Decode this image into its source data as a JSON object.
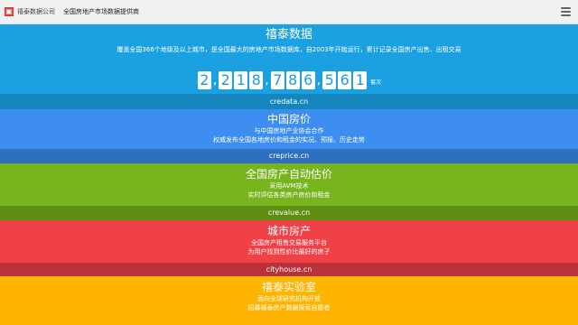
{
  "header": {
    "logo_glyph": "▣",
    "company": "禧泰数据公司",
    "tagline": "全国房地产市场数据提供商",
    "menu_icon": "hamburger-menu-icon"
  },
  "counter": {
    "digits": [
      "2",
      "218",
      "786",
      "561"
    ],
    "unit": "套次"
  },
  "sections": [
    {
      "title": "禧泰数据",
      "lines": [
        "覆盖全国366个地级及以上城市，是全国最大的房地产市场数据库，自2003年开始运行，累计记录全国房产出售、出租交易"
      ],
      "domain": "credata.cn",
      "color": "#1ba1e2",
      "bar_color": "#1585bd"
    },
    {
      "title": "中国房价",
      "lines": [
        "与中国房地产业协会合作",
        "权威发布全国各地房价和租金的实况、预报、历史走势"
      ],
      "domain": "creprice.cn",
      "color": "#3d8ef0",
      "bar_color": "#2f6fc0"
    },
    {
      "title": "全国房产自动估价",
      "lines": [
        "采用AVM技术",
        "实时评估各类房产房价和租金"
      ],
      "domain": "crevalue.cn",
      "color": "#78b41e",
      "bar_color": "#5e8f12"
    },
    {
      "title": "城市房产",
      "lines": [
        "全国房产租售交易服务平台",
        "为用户找到性价比最好的房子"
      ],
      "domain": "cityhouse.cn",
      "color": "#f04147",
      "bar_color": "#b9323a"
    },
    {
      "title": "禧泰实验室",
      "lines": [
        "面向全球研究机构开放",
        "招募禧泰房产数据探索自愿者"
      ],
      "color": "#ffb400"
    }
  ]
}
